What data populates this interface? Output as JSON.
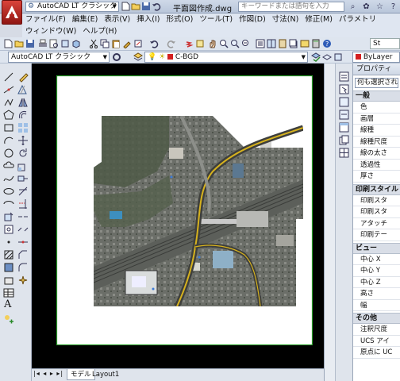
{
  "app": {
    "workspace": "AutoCAD LT クラシック",
    "document_title": "平面図作成.dwg",
    "search_placeholder": "キーワードまたは語句を入力"
  },
  "menu": {
    "row1": [
      "ファイル(F)",
      "編集(E)",
      "表示(V)",
      "挿入(I)",
      "形式(O)",
      "ツール(T)",
      "作図(D)",
      "寸法(N)",
      "修正(M)",
      "パラメトリ"
    ],
    "row2": [
      "ウィンドウ(W)",
      "ヘルプ(H)"
    ]
  },
  "toolbar": {
    "workspace_combo": "AutoCAD LT クラシック",
    "layer_combo": "C-BGD",
    "bylayer": "ByLayer",
    "st_label": "St"
  },
  "properties": {
    "title": "プロパティ",
    "selection": "何も選択されて",
    "sections": [
      {
        "name": "一般",
        "rows": [
          "色",
          "画層",
          "線種",
          "線種尺度",
          "線の太さ",
          "透過性",
          "厚さ"
        ]
      },
      {
        "name": "印刷スタイル",
        "rows": [
          "印刷スタ",
          "印刷スタ",
          "アタッチ",
          "印刷テー"
        ]
      },
      {
        "name": "ビュー",
        "rows": [
          "中心 X",
          "中心 Y",
          "中心 Z",
          "高さ",
          "幅"
        ]
      },
      {
        "name": "その他",
        "rows": [
          "注釈尺度",
          "UCS アイ",
          "原点に UC"
        ]
      }
    ]
  },
  "tabs": {
    "model": "モデル",
    "layout": "Layout1"
  },
  "colors": {
    "accent": "#2e5cb8",
    "title_bg": "#c4d0e2",
    "drawing_bg": "#000000",
    "layer_swatch": "#d42020"
  }
}
